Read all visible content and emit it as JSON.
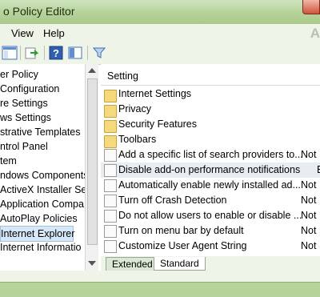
{
  "window": {
    "title": "o Policy Editor",
    "ghost_text": "A"
  },
  "menu": {
    "items": [
      "View",
      "Help"
    ]
  },
  "toolbar": {
    "icons": [
      "console-tree-icon",
      "export-icon",
      "help-icon",
      "show-pane-icon",
      "filter-icon"
    ]
  },
  "tree": {
    "items": [
      {
        "label": "er Policy",
        "selected": false
      },
      {
        "label": " Configuration",
        "selected": false
      },
      {
        "label": "re Settings",
        "selected": false
      },
      {
        "label": "ws Settings",
        "selected": false
      },
      {
        "label": "strative Templates",
        "selected": false
      },
      {
        "label": "ntrol Panel",
        "selected": false
      },
      {
        "label": "tem",
        "selected": false
      },
      {
        "label": "ndows Components",
        "selected": false
      },
      {
        "label": "ActiveX Installer Ser",
        "selected": false
      },
      {
        "label": "Application Compa",
        "selected": false
      },
      {
        "label": "AutoPlay Policies",
        "selected": false
      },
      {
        "label": "Internet Explorer",
        "selected": true
      },
      {
        "label": "Internet Informatio",
        "selected": false
      }
    ]
  },
  "list": {
    "column_setting": "Setting",
    "items": [
      {
        "kind": "folder",
        "label": "Internet Settings",
        "state": ""
      },
      {
        "kind": "folder",
        "label": "Privacy",
        "state": ""
      },
      {
        "kind": "folder",
        "label": "Security Features",
        "state": ""
      },
      {
        "kind": "folder",
        "label": "Toolbars",
        "state": ""
      },
      {
        "kind": "policy",
        "label": "Add a specific list of search providers to...",
        "state": "Not"
      },
      {
        "kind": "policy",
        "label": "Disable add-on performance notifications",
        "state": "E"
      },
      {
        "kind": "policy",
        "label": "Automatically enable newly installed ad...",
        "state": "Not"
      },
      {
        "kind": "policy",
        "label": "Turn off Crash Detection",
        "state": "Not"
      },
      {
        "kind": "policy",
        "label": "Do not allow users to enable or disable ...",
        "state": "Not"
      },
      {
        "kind": "policy",
        "label": "Turn on menu bar by default",
        "state": "Not"
      },
      {
        "kind": "policy",
        "label": "Customize User Agent String",
        "state": "Not"
      }
    ]
  },
  "tabs": {
    "extended": "Extended",
    "standard": "Standard",
    "active": "Standard"
  }
}
